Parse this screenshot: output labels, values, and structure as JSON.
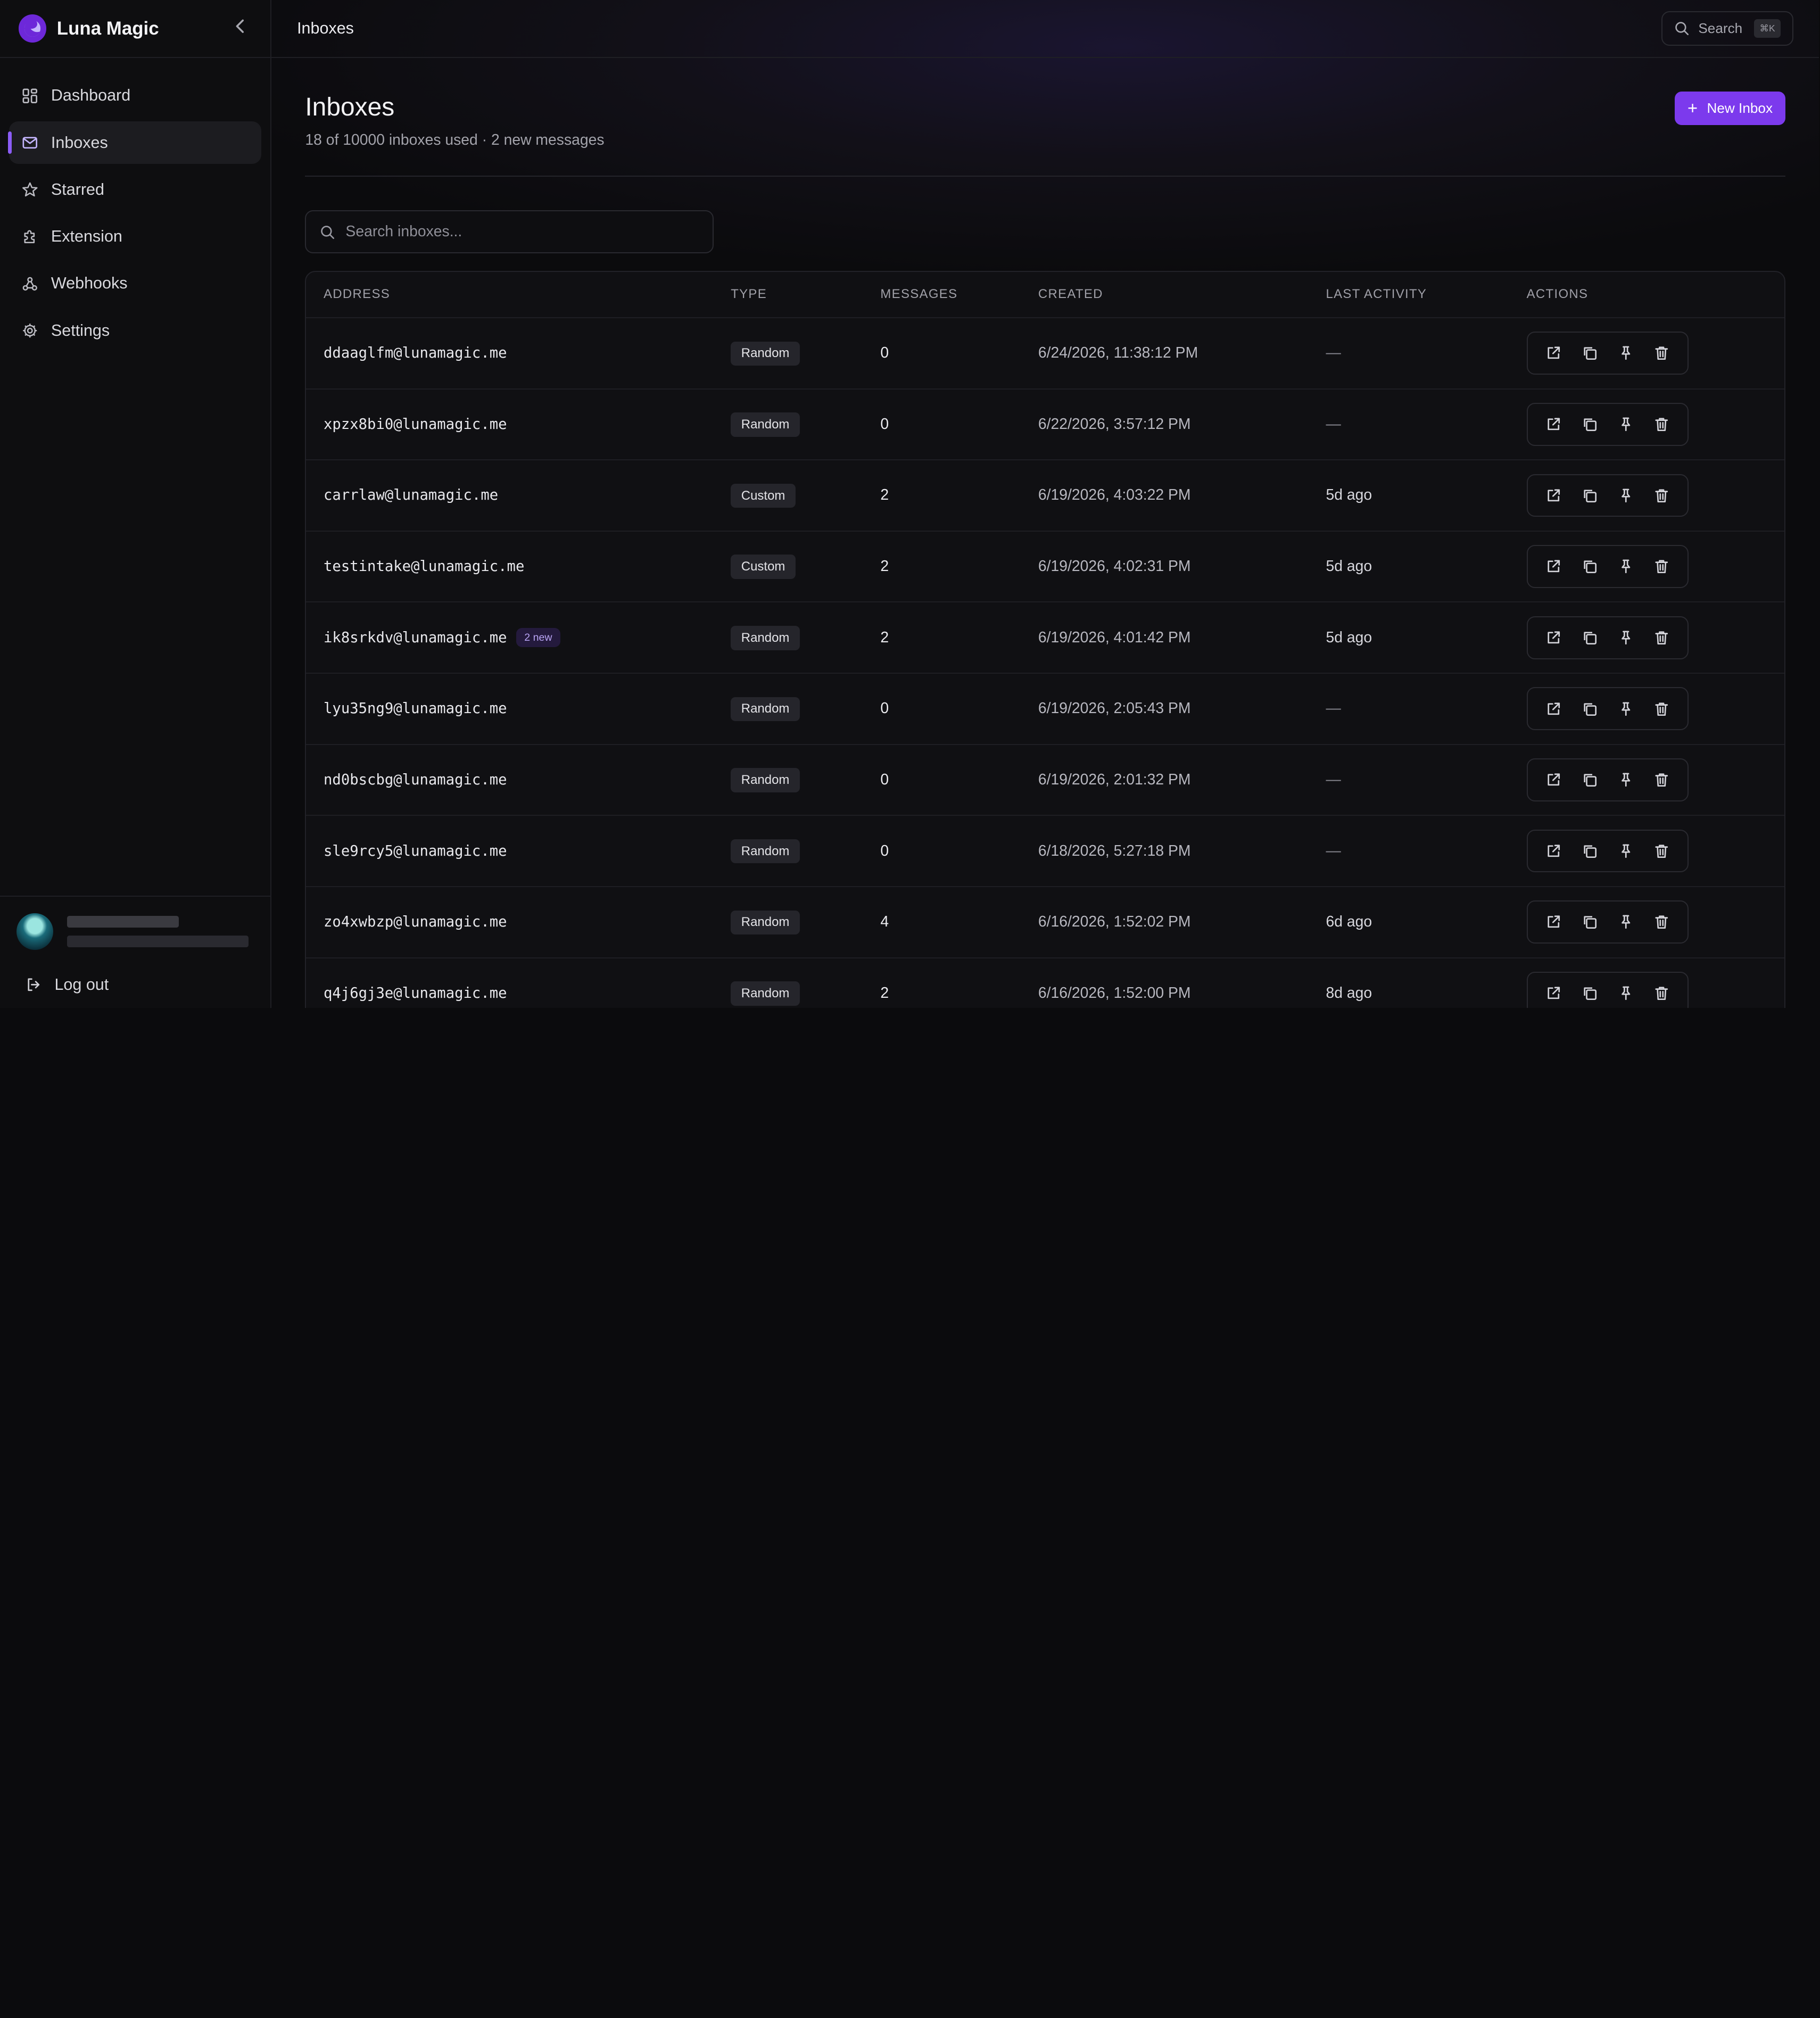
{
  "app": {
    "name": "Luna Magic"
  },
  "sidebar": {
    "items": [
      {
        "label": "Dashboard",
        "icon": "dashboard-icon"
      },
      {
        "label": "Inboxes",
        "icon": "mail-icon"
      },
      {
        "label": "Starred",
        "icon": "star-icon"
      },
      {
        "label": "Extension",
        "icon": "puzzle-icon"
      },
      {
        "label": "Webhooks",
        "icon": "webhook-icon"
      },
      {
        "label": "Settings",
        "icon": "gear-icon"
      }
    ],
    "active_index": 1,
    "logout_label": "Log out"
  },
  "topbar": {
    "title": "Inboxes",
    "search_label": "Search",
    "search_shortcut": "⌘K"
  },
  "page": {
    "title": "Inboxes",
    "subtitle": "18 of 10000 inboxes used · 2 new messages",
    "new_button_label": "New Inbox",
    "search_placeholder": "Search inboxes..."
  },
  "table": {
    "headers": [
      "ADDRESS",
      "TYPE",
      "MESSAGES",
      "CREATED",
      "LAST ACTIVITY",
      "ACTIONS"
    ],
    "rows": [
      {
        "address": "ddaaglfm@lunamagic.me",
        "badge": "",
        "type": "Random",
        "messages": "0",
        "created": "6/24/2026, 11:38:12 PM",
        "last_activity": "—"
      },
      {
        "address": "xpzx8bi0@lunamagic.me",
        "badge": "",
        "type": "Random",
        "messages": "0",
        "created": "6/22/2026, 3:57:12 PM",
        "last_activity": "—"
      },
      {
        "address": "carrlaw@lunamagic.me",
        "badge": "",
        "type": "Custom",
        "messages": "2",
        "created": "6/19/2026, 4:03:22 PM",
        "last_activity": "5d ago"
      },
      {
        "address": "testintake@lunamagic.me",
        "badge": "",
        "type": "Custom",
        "messages": "2",
        "created": "6/19/2026, 4:02:31 PM",
        "last_activity": "5d ago"
      },
      {
        "address": "ik8srkdv@lunamagic.me",
        "badge": "2 new",
        "type": "Random",
        "messages": "2",
        "created": "6/19/2026, 4:01:42 PM",
        "last_activity": "5d ago"
      },
      {
        "address": "lyu35ng9@lunamagic.me",
        "badge": "",
        "type": "Random",
        "messages": "0",
        "created": "6/19/2026, 2:05:43 PM",
        "last_activity": "—"
      },
      {
        "address": "nd0bscbg@lunamagic.me",
        "badge": "",
        "type": "Random",
        "messages": "0",
        "created": "6/19/2026, 2:01:32 PM",
        "last_activity": "—"
      },
      {
        "address": "sle9rcy5@lunamagic.me",
        "badge": "",
        "type": "Random",
        "messages": "0",
        "created": "6/18/2026, 5:27:18 PM",
        "last_activity": "—"
      },
      {
        "address": "zo4xwbzp@lunamagic.me",
        "badge": "",
        "type": "Random",
        "messages": "4",
        "created": "6/16/2026, 1:52:02 PM",
        "last_activity": "6d ago"
      },
      {
        "address": "q4j6gj3e@lunamagic.me",
        "badge": "",
        "type": "Random",
        "messages": "2",
        "created": "6/16/2026, 1:52:00 PM",
        "last_activity": "8d ago"
      }
    ],
    "action_icons": [
      "external-link-icon",
      "copy-icon",
      "pin-icon",
      "trash-icon"
    ]
  },
  "colors": {
    "accent": "#7c3aed",
    "background": "#0b0b0d",
    "sidebar": "#0e0e10"
  }
}
